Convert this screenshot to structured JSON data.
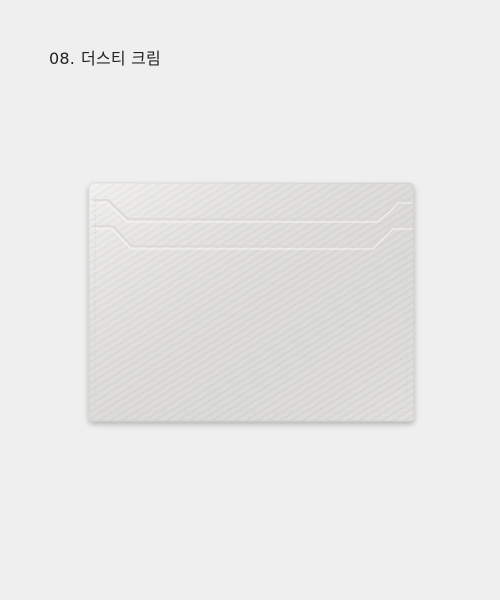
{
  "product": {
    "number": "08.",
    "color_name": "더스티 크림"
  },
  "colors": {
    "background": "#efefef",
    "leather": "#ececea",
    "stitching": "#d6d6d2"
  }
}
